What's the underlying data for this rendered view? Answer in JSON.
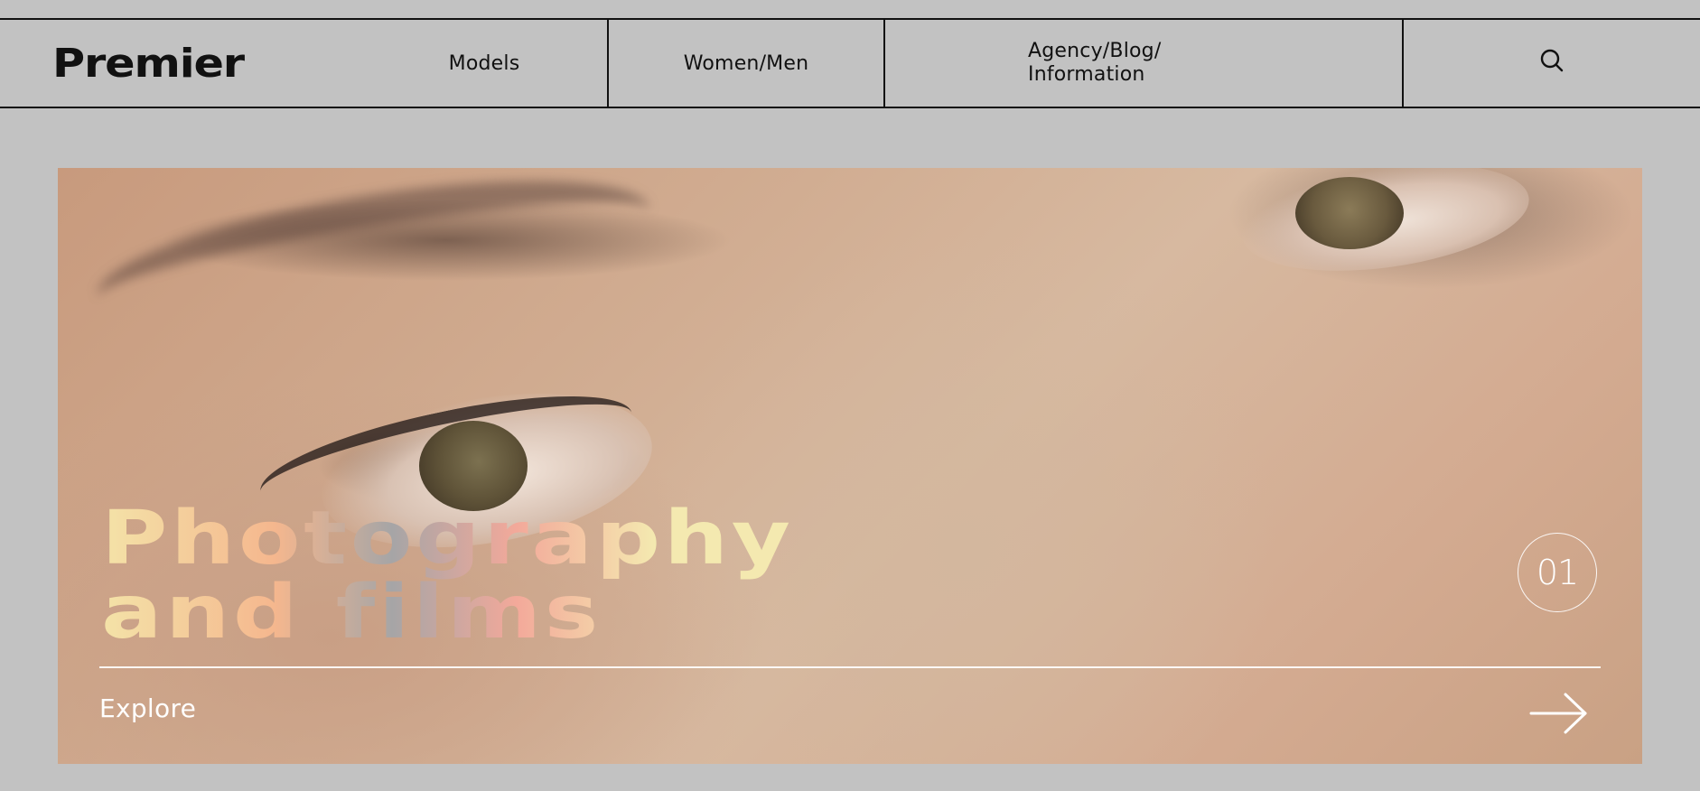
{
  "header": {
    "logo": "Premier",
    "nav": {
      "models": "Models",
      "women_men": "Women/Men",
      "agency_line1": "Agency/Blog/",
      "agency_line2": "Information"
    },
    "search_icon": "search-icon"
  },
  "hero": {
    "title_line1": "Photography",
    "title_line2": "and films",
    "slide_number": "01",
    "cta_label": "Explore",
    "cta_icon": "arrow-right-icon",
    "colors": {
      "page_background": "#c2c2c2",
      "title_gradient": [
        "#f4e3a8",
        "#f5b78e",
        "#a6a5a6",
        "#f3a99a",
        "#f4e9b0"
      ],
      "overlay_text": "#ffffff"
    }
  }
}
